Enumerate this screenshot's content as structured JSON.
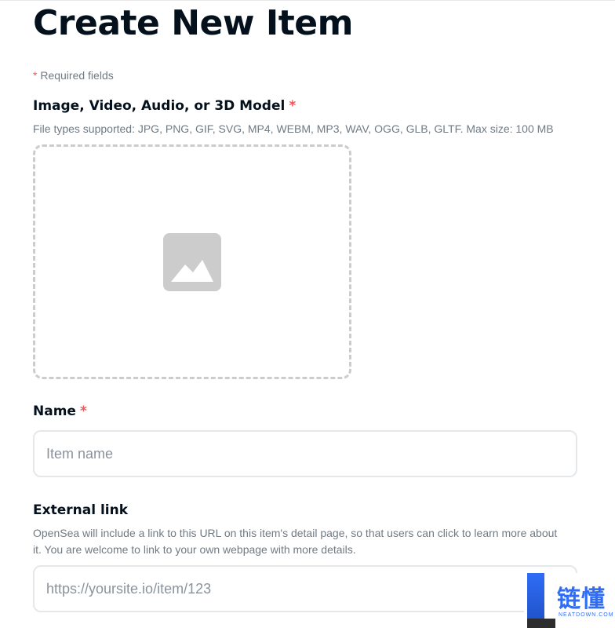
{
  "page": {
    "title": "Create New Item",
    "required_note": {
      "star": "*",
      "text": " Required fields"
    }
  },
  "media": {
    "label": "Image, Video, Audio, or 3D Model",
    "required_star": "*",
    "help": "File types supported: JPG, PNG, GIF, SVG, MP4, WEBM, MP3, WAV, OGG, GLB, GLTF. Max size: 100 MB",
    "icon": "image-icon"
  },
  "name_field": {
    "label": "Name",
    "required_star": "*",
    "placeholder": "Item name",
    "value": ""
  },
  "external_link": {
    "label": "External link",
    "help": "OpenSea will include a link to this URL on this item's detail page, so that users can click to learn more about it. You are welcome to link to your own webpage with more details.",
    "placeholder": "https://yoursite.io/item/123",
    "value": ""
  },
  "watermark": {
    "text": "链懂",
    "subtext": "NEATDOWN.COM"
  },
  "colors": {
    "required_star": "#eb5757",
    "heading": "#04111d",
    "muted": "#707a83",
    "border": "#e5e8eb",
    "dropzone_border": "#cccccc",
    "icon_gray": "#cccccc"
  }
}
